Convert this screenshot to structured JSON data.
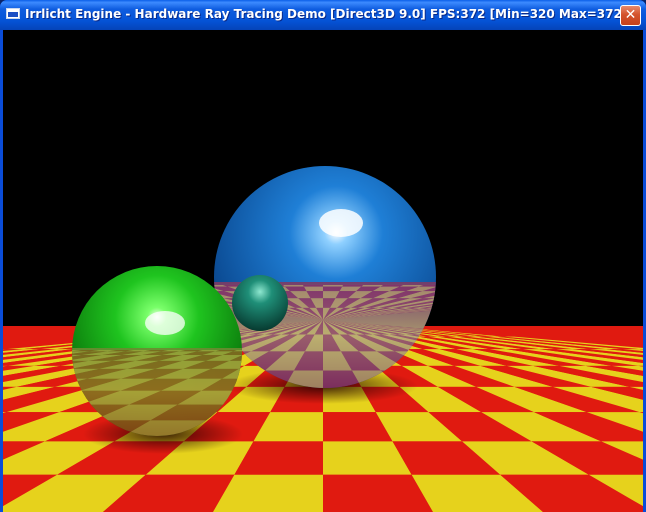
{
  "window": {
    "title": "Irrlicht Engine - Hardware Ray Tracing Demo [Direct3D 9.0] FPS:372 [Min=320 Max=372]",
    "close_glyph": "✕"
  },
  "icons": {
    "app": "window-app-icon",
    "close": "close-icon"
  },
  "scene": {
    "floor_colors": [
      "#e01a10",
      "#e6d21c"
    ],
    "sky_color": "#000000",
    "spheres": [
      "blue",
      "green",
      "teal"
    ]
  }
}
